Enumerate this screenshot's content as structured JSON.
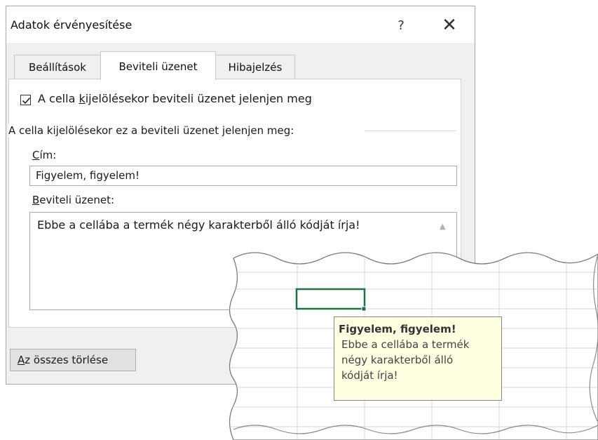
{
  "dialog": {
    "title": "Adatok érvényesítése",
    "help_label": "?",
    "close_label": "✕"
  },
  "tabs": [
    {
      "label": "Beállítások",
      "active": false
    },
    {
      "label": "Beviteli üzenet",
      "active": true
    },
    {
      "label": "Hibajelzés",
      "active": false
    }
  ],
  "settings": {
    "checkbox_checked": true,
    "checkbox_label_pre": "A cella ",
    "checkbox_label_key": "k",
    "checkbox_label_post": "ijelölésekor beviteli üzenet jelenjen meg",
    "group_label": "A cella kijelölésekor ez a beviteli üzenet jelenjen meg:",
    "title_label_key": "C",
    "title_label_rest": "ím:",
    "title_value": "Figyelem, figyelem!",
    "message_label_key": "B",
    "message_label_rest": "eviteli üzenet:",
    "message_value": "Ebbe a cellába a termék négy karakterből álló kódját írja!"
  },
  "footer": {
    "clear_key": "A",
    "clear_rest": "z összes törlése"
  },
  "colors": {
    "selection_border": "#1e7145",
    "tooltip_bg": "#ffffe1",
    "grid_line": "#d4d4d4"
  },
  "tooltip": {
    "title": "Figyelem, figyelem!",
    "lines": [
      "Ebbe a cellába a termék",
      "négy karakterből  álló",
      "kódját írja!"
    ]
  }
}
